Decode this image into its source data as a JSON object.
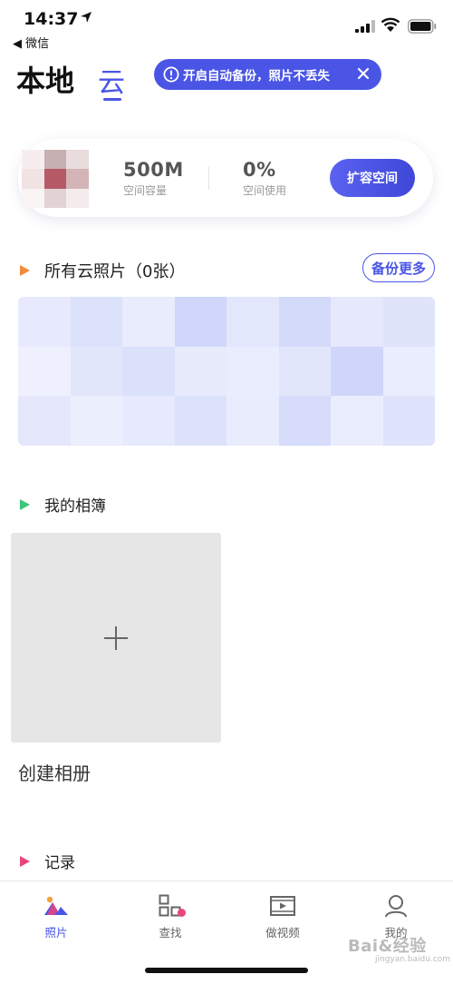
{
  "status_bar": {
    "time": "14:37",
    "back_app": "◀ 微信"
  },
  "header": {
    "tab_local": "本地",
    "tab_cloud": "云",
    "banner_text": "开启自动备份，照片不丢失"
  },
  "storage": {
    "capacity_value": "500M",
    "capacity_label": "空间容量",
    "usage_value": "0%",
    "usage_label": "空间使用",
    "expand_button": "扩容空间"
  },
  "sections": {
    "cloud_photos_title": "所有云照片（0张）",
    "backup_more_button": "备份更多",
    "albums_title": "我的相簿",
    "create_album_label": "创建相册",
    "records_title": "记录"
  },
  "tabbar": {
    "photos": "照片",
    "search": "查找",
    "video": "做视频",
    "me": "我的"
  },
  "colors": {
    "accent": "#4a55e6",
    "tri_orange": "#f28a3a",
    "tri_green": "#3cc679",
    "tri_pink": "#e8457d"
  },
  "watermark": {
    "brand": "Bai&经验",
    "url": "jingyan.baidu.com"
  }
}
